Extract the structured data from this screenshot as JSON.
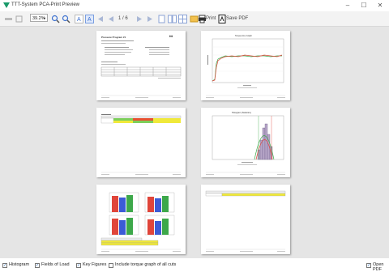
{
  "window": {
    "title": "TTT-System PCA-Print Preview",
    "controls": [
      "–",
      "☐",
      "✕"
    ]
  },
  "toolbar": {
    "zoom_value": "39.2%",
    "page_indicator": "1 / 6",
    "print_label": "Print",
    "save_pdf_label": "Save PDF"
  },
  "pages": [
    {
      "id": 1,
      "kind": "report",
      "heading": "Pressure Program #1"
    },
    {
      "id": 2,
      "kind": "line-chart",
      "heading": "Torque-time Graph"
    },
    {
      "id": 3,
      "kind": "table",
      "heading": ""
    },
    {
      "id": 4,
      "kind": "histogram",
      "heading": "Histogram (Statistics)"
    },
    {
      "id": 5,
      "kind": "bar-grid",
      "heading": ""
    },
    {
      "id": 6,
      "kind": "table",
      "heading": ""
    }
  ],
  "statusbar": {
    "options": [
      {
        "label": "Histogram",
        "checked": true
      },
      {
        "label": "Fields of Load",
        "checked": true
      },
      {
        "label": "Key Figures",
        "checked": true
      },
      {
        "label": "Include torque graph of all cuts",
        "checked": false
      }
    ],
    "open_pdf": {
      "label": "Open PDF",
      "checked": true
    }
  },
  "colors": {
    "accent": "#1a5fb4",
    "app_icon": "#1a9a6a",
    "preview_bg": "#e5e5e5",
    "bar_red": "#e0453a",
    "bar_blue": "#3b5bd6",
    "bar_green": "#3da84a",
    "cell_yellow": "#f0e93a",
    "cell_green": "#7ccf5a",
    "cell_red": "#e8502f"
  }
}
